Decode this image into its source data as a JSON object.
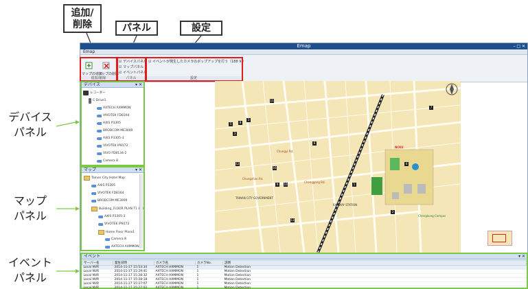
{
  "callouts": {
    "add_delete": "追加/\n削除",
    "panel": "パネル",
    "settings": "設定"
  },
  "side_labels": {
    "device_panel": "デバイス\nパネル",
    "map_panel": "マップ\nパネル",
    "event_panel": "イベント\nパネル"
  },
  "window": {
    "title": "Emap",
    "menu": "Emap",
    "controls": "– □ ✕"
  },
  "ribbon": {
    "add_map": "マップの追加",
    "delete_map": "マップの削除",
    "add_delete_group": "追加/削除",
    "panel_checks": [
      "デバイスパネル",
      "マップパネル",
      "イベントパネル"
    ],
    "panel_group": "パネル",
    "setting_check": "イベントが発生したカメラのポップアップを行う（188 9 ）",
    "setting_group": "設定"
  },
  "device_panel": {
    "title": "デバイス",
    "recorder": "レコーダー",
    "server": "C:Drive1",
    "cameras": [
      "AXTECH AXMMON",
      "VIVOTEK FD8164",
      "AXIS P3305",
      "BRODCOM ME3009",
      "AXIS P3305-3",
      "VIVOTEK IP8172",
      "VIVO FD8134-2",
      "Camera 8"
    ]
  },
  "map_panel": {
    "title": "マップ",
    "items": [
      "Tainan City Hotel Map",
      "AXIS P3305",
      "VIVOTEK FD8164",
      "BRODCOM ME3009",
      "Building_FLOOR PLAN T1 & 4",
      "AXIS P3305-3",
      "VIVOTEK IP8172",
      "Home Floor Plans1",
      "Camera 8",
      "AXTECH AXMMON"
    ]
  },
  "map": {
    "labels": [
      "TAINAN CITY GOVERNMENT",
      "RAILWAY STATION",
      "Chungyi Rd.",
      "Chenggong Rd.",
      "Chungshan Rd.",
      "Chengkung Campus",
      "NCKU"
    ],
    "numbers": [
      "5",
      "8",
      "3",
      "16",
      "9",
      "10",
      "4",
      "1",
      "2",
      "7",
      "3",
      "12",
      "6",
      "13",
      "11"
    ]
  },
  "event_panel": {
    "title": "イベント",
    "columns": [
      "サーバー名",
      "発生日時",
      "カメラ名",
      "カメラNo.",
      "説明"
    ],
    "rows": [
      [
        "Local NVR",
        "2014-11-17 15:53:34",
        "AXTECH AXMMON",
        "1",
        "Motion Detection"
      ],
      [
        "Local NVR",
        "2014-11-17 15:29:41",
        "AXTECH AXMMON",
        "1",
        "Motion Detection"
      ],
      [
        "Local NVR",
        "2014-11-17 15:28:32",
        "AXTECH AXMMON",
        "1",
        "Motion Detection"
      ],
      [
        "Local NVR",
        "2014-11-17 15:28:18",
        "AXTECH AXMMON",
        "1",
        "Motion Detection"
      ],
      [
        "Local NVR",
        "2014-11-17 15:27:07",
        "AXTECH AXMMON",
        "1",
        "Motion Detection"
      ],
      [
        "Local NVR",
        "2014-11-17 15:27:02",
        "AXTECH AXMMON",
        "1",
        "Motion Detection"
      ],
      [
        "Local NVR",
        "2014-11-17 15:26:48",
        "AXTECH AXMMON",
        "1",
        "Motion Detection"
      ]
    ]
  },
  "colors": {
    "highlight_red": "#e01b1b",
    "highlight_green": "#7ac943",
    "titlebar": "#1f4e8c"
  }
}
